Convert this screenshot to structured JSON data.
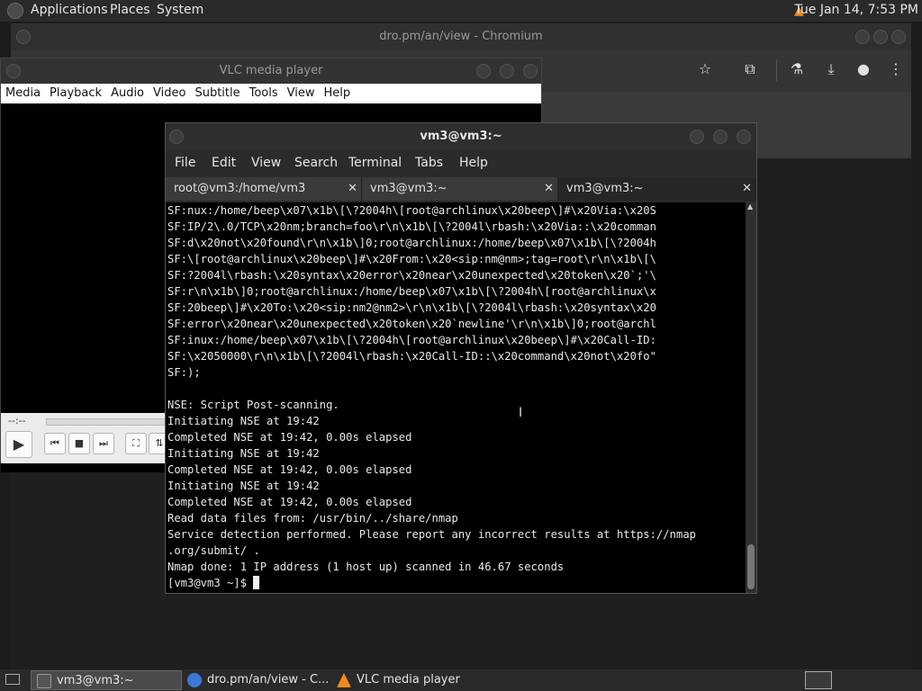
{
  "top_panel": {
    "menus": [
      "Applications",
      "Places",
      "System"
    ],
    "clock": "Tue Jan 14,  7:53 PM"
  },
  "chromium": {
    "title": "dro.pm/an/view - Chromium",
    "toolbar_icons": [
      "star-icon",
      "extensions-icon",
      "labs-icon",
      "download-icon",
      "profile-icon",
      "menu-icon"
    ]
  },
  "vlc": {
    "title": "VLC media player",
    "menus": [
      "Media",
      "Playback",
      "Audio",
      "Video",
      "Subtitle",
      "Tools",
      "View",
      "Help"
    ],
    "time": "--:--"
  },
  "terminal": {
    "title": "vm3@vm3:~",
    "menus": [
      "File",
      "Edit",
      "View",
      "Search",
      "Terminal",
      "Tabs",
      "Help"
    ],
    "tabs": [
      {
        "label": "root@vm3:/home/vm3"
      },
      {
        "label": "vm3@vm3:~"
      },
      {
        "label": "vm3@vm3:~"
      }
    ],
    "lines": [
      "SF:nux:/home/beep\\x07\\x1b\\[\\?2004h\\[root@archlinux\\x20beep\\]#\\x20Via:\\x20S",
      "SF:IP/2\\.0/TCP\\x20nm;branch=foo\\r\\n\\x1b\\[\\?2004l\\rbash:\\x20Via::\\x20comman",
      "SF:d\\x20not\\x20found\\r\\n\\x1b\\]0;root@archlinux:/home/beep\\x07\\x1b\\[\\?2004h",
      "SF:\\[root@archlinux\\x20beep\\]#\\x20From:\\x20<sip:nm@nm>;tag=root\\r\\n\\x1b\\[\\",
      "SF:?2004l\\rbash:\\x20syntax\\x20error\\x20near\\x20unexpected\\x20token\\x20`;'\\",
      "SF:r\\n\\x1b\\]0;root@archlinux:/home/beep\\x07\\x1b\\[\\?2004h\\[root@archlinux\\x",
      "SF:20beep\\]#\\x20To:\\x20<sip:nm2@nm2>\\r\\n\\x1b\\[\\?2004l\\rbash:\\x20syntax\\x20",
      "SF:error\\x20near\\x20unexpected\\x20token\\x20`newline'\\r\\n\\x1b\\]0;root@archl",
      "SF:inux:/home/beep\\x07\\x1b\\[\\?2004h\\[root@archlinux\\x20beep\\]#\\x20Call-ID:",
      "SF:\\x2050000\\r\\n\\x1b\\[\\?2004l\\rbash:\\x20Call-ID::\\x20command\\x20not\\x20fo\"",
      "SF:);",
      "",
      "NSE: Script Post-scanning.",
      "Initiating NSE at 19:42",
      "Completed NSE at 19:42, 0.00s elapsed",
      "Initiating NSE at 19:42",
      "Completed NSE at 19:42, 0.00s elapsed",
      "Initiating NSE at 19:42",
      "Completed NSE at 19:42, 0.00s elapsed",
      "Read data files from: /usr/bin/../share/nmap",
      "Service detection performed. Please report any incorrect results at https://nmap",
      ".org/submit/ .",
      "Nmap done: 1 IP address (1 host up) scanned in 46.67 seconds"
    ],
    "prompt": "[vm3@vm3 ~]$ "
  },
  "taskbar": {
    "items": [
      {
        "label": "vm3@vm3:~",
        "active": true
      },
      {
        "label": "dro.pm/an/view - C...",
        "active": false
      },
      {
        "label": "VLC media player",
        "active": false
      }
    ]
  }
}
